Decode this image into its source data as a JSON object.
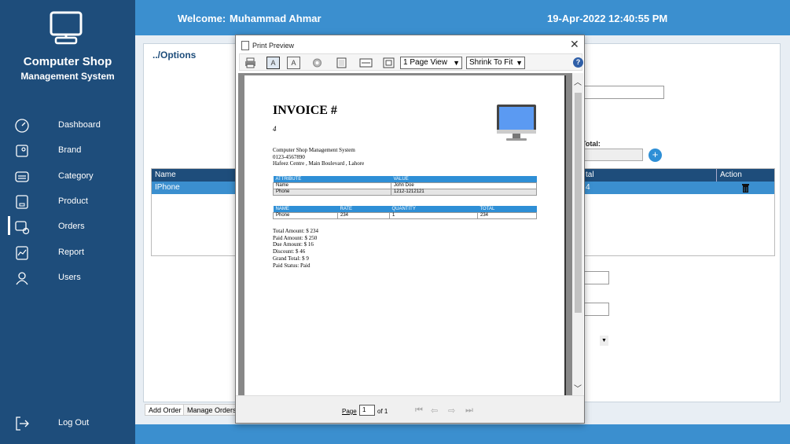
{
  "sidebar": {
    "title": "Computer Shop",
    "subtitle": "Management System",
    "items": [
      {
        "label": "Dashboard",
        "icon": "gauge-icon"
      },
      {
        "label": "Brand",
        "icon": "tag-icon"
      },
      {
        "label": "Category",
        "icon": "category-icon"
      },
      {
        "label": "Product",
        "icon": "product-icon"
      },
      {
        "label": "Orders",
        "icon": "orders-icon"
      },
      {
        "label": "Report",
        "icon": "report-icon"
      },
      {
        "label": "Users",
        "icon": "user-icon"
      }
    ],
    "logout": "Log Out",
    "active_index": 4
  },
  "header": {
    "welcome": "Welcome:",
    "user": "Muhammad Ahmar",
    "datetime": "19-Apr-2022 12:40:55 PM"
  },
  "main": {
    "breadcrumb": "../Options",
    "grand_total_label": "Total:",
    "add_button": "+",
    "grid": {
      "columns": {
        "name": "Name",
        "total": "tal",
        "action": "Action"
      },
      "row": {
        "name": "IPhone",
        "total": "4"
      }
    },
    "tabs": [
      "Add Order",
      "Manage Orders"
    ]
  },
  "dialog": {
    "title": "Print Preview",
    "close": "✕",
    "toolbar": {
      "view_select": "1 Page View",
      "zoom_select": "Shrink To Fit"
    },
    "page_label": "Page",
    "page_value": "1",
    "page_of": "of 1"
  },
  "invoice": {
    "title": "INVOICE #",
    "number": "4",
    "company": "Computer Shop Management System",
    "phone": "0123-4567890",
    "address": "Hafeez Centre , Main Boulevard , Lahore",
    "attributes_table": {
      "headers": [
        "ATTRIBUTE",
        "VALUE"
      ],
      "rows": [
        [
          "Name",
          "John Doe"
        ],
        [
          "Phone",
          "1212-1212121"
        ]
      ]
    },
    "items_table": {
      "headers": [
        "NAME",
        "RATE",
        "QUANTITY",
        "TOTAL"
      ],
      "rows": [
        [
          "Phone",
          "234",
          "1",
          "234"
        ]
      ]
    },
    "totals": [
      "Total Amount: $ 234",
      "Paid Amount: $ 250",
      "Due Amount: $ 16",
      "Discount: $ 46",
      "Grand Total: $ 9",
      "Paid Status: Paid"
    ]
  }
}
